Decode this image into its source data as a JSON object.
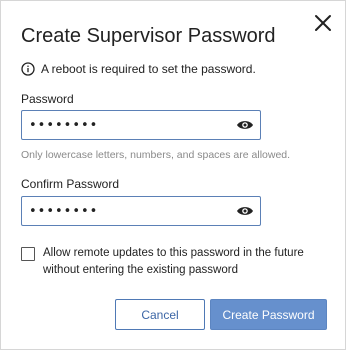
{
  "dialog": {
    "title": "Create Supervisor Password",
    "notice": "A reboot is required to set the password.",
    "password": {
      "label": "Password",
      "value": "••••••••"
    },
    "hint": "Only lowercase letters, numbers, and spaces are allowed.",
    "confirm": {
      "label": "Confirm Password",
      "value": "••••••••"
    },
    "remote_updates": {
      "checked": false,
      "label": "Allow remote updates to this password in the future without entering the existing password"
    },
    "buttons": {
      "cancel": "Cancel",
      "create": "Create Password"
    }
  },
  "icons": {
    "close": "close-icon",
    "info": "info-icon",
    "eye": "eye-icon"
  },
  "colors": {
    "accent": "#6690cd",
    "field_border": "#5b80b6",
    "hint": "#8a8a8a"
  }
}
